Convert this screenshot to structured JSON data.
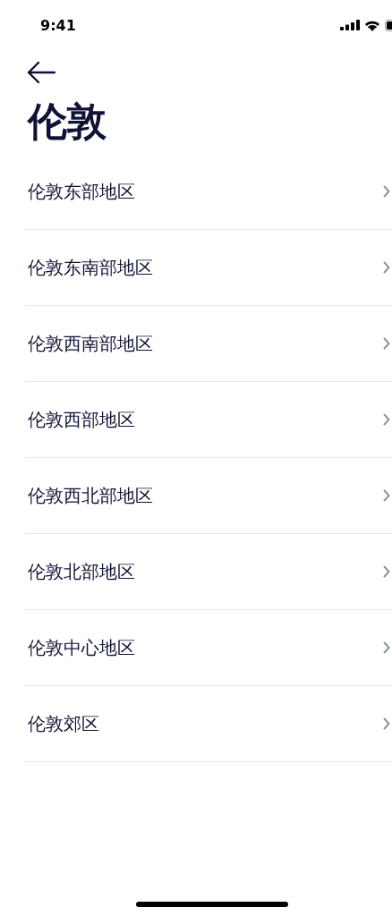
{
  "status_bar": {
    "time": "9:41"
  },
  "title": "伦敦",
  "items": [
    {
      "label": "伦敦东部地区"
    },
    {
      "label": "伦敦东南部地区"
    },
    {
      "label": "伦敦西南部地区"
    },
    {
      "label": "伦敦西部地区"
    },
    {
      "label": "伦敦西北部地区"
    },
    {
      "label": "伦敦北部地区"
    },
    {
      "label": "伦敦中心地区"
    },
    {
      "label": "伦敦郊区"
    }
  ]
}
